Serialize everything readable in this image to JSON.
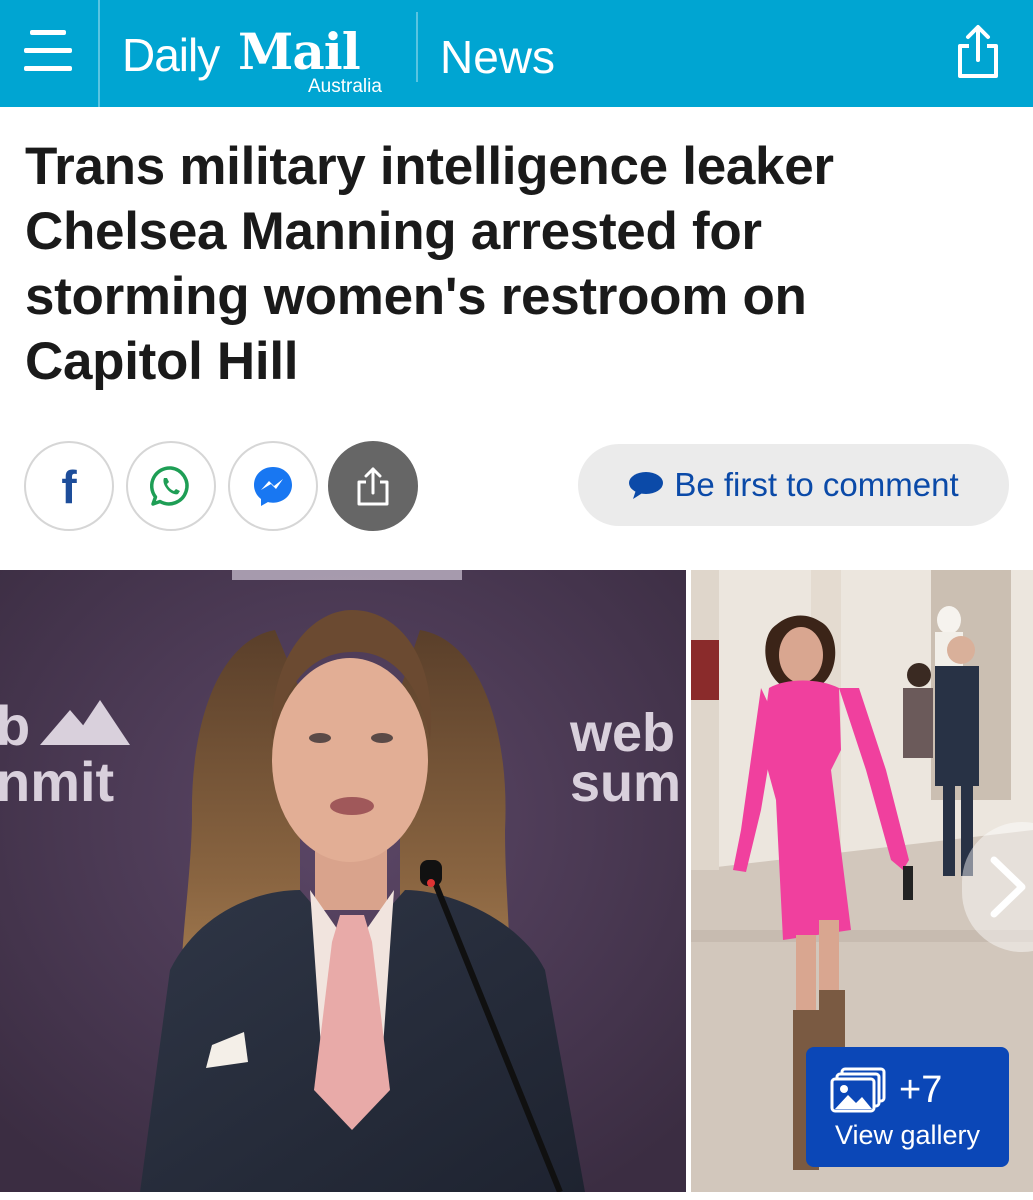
{
  "header": {
    "logo_daily": "Daily",
    "logo_mail": "Mail",
    "logo_region": "Australia",
    "section": "News"
  },
  "article": {
    "headline_lines": [
      "Trans military intelligence leaker",
      "Chelsea Manning arrested for",
      "storming women's restroom on",
      "Capitol Hill"
    ]
  },
  "social": {
    "facebook": "f",
    "comment_label": "Be first to comment"
  },
  "hero_image": {
    "backdrop_text_left_top": "b",
    "backdrop_text_left_bottom": "nmit",
    "backdrop_text_right_top": "web",
    "backdrop_text_right_bottom": "sum"
  },
  "gallery": {
    "count": "+7",
    "label": "View gallery"
  },
  "colors": {
    "brand": "#00a5d2",
    "comment_text": "#0b4aa8",
    "gallery_button": "#0b47b7",
    "share_button": "#666666"
  }
}
